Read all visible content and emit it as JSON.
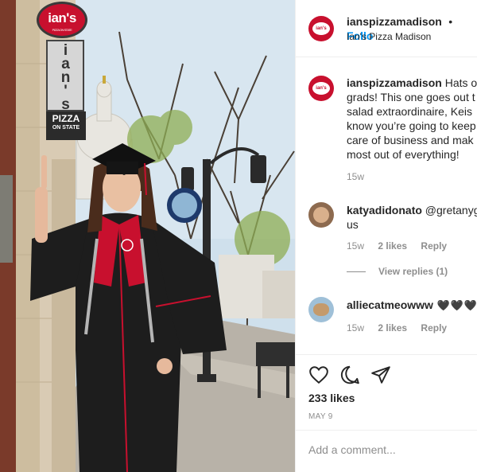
{
  "photo": {
    "sign_top": "ian's",
    "sign_top_small": "PIZZA ON STATE",
    "sign_vertical": "ian's",
    "sign_pizza_line1": "PIZZA",
    "sign_pizza_line2": "ON STATE"
  },
  "header": {
    "username": "ianspizzamadison",
    "dot": "•",
    "follow_label": "Follo",
    "subtitle": "Ian's Pizza Madison"
  },
  "caption": {
    "username": "ianspizzamadison",
    "text": " Hats o grads! This one goes out t / salad extraordinaire, Keis know you’re going to keep care of business and mak most out of everything!",
    "age": "15w"
  },
  "comments": [
    {
      "username": "katyadidonato",
      "text": " @gretanyg us",
      "age": "15w",
      "likes": "2 likes",
      "reply": "Reply",
      "view_replies": "View replies (1)"
    },
    {
      "username": "alliecatmeowww",
      "text": " 🖤🖤🖤",
      "age": "15w",
      "likes": "2 likes",
      "reply": "Reply"
    }
  ],
  "actions": {
    "likes": "233 likes",
    "date": "MAY 9"
  },
  "add_comment": {
    "placeholder": "Add a comment..."
  },
  "colors": {
    "brand_red": "#c8102e",
    "follow_blue": "#0095f6",
    "muted_gray": "#8e8e8e"
  }
}
